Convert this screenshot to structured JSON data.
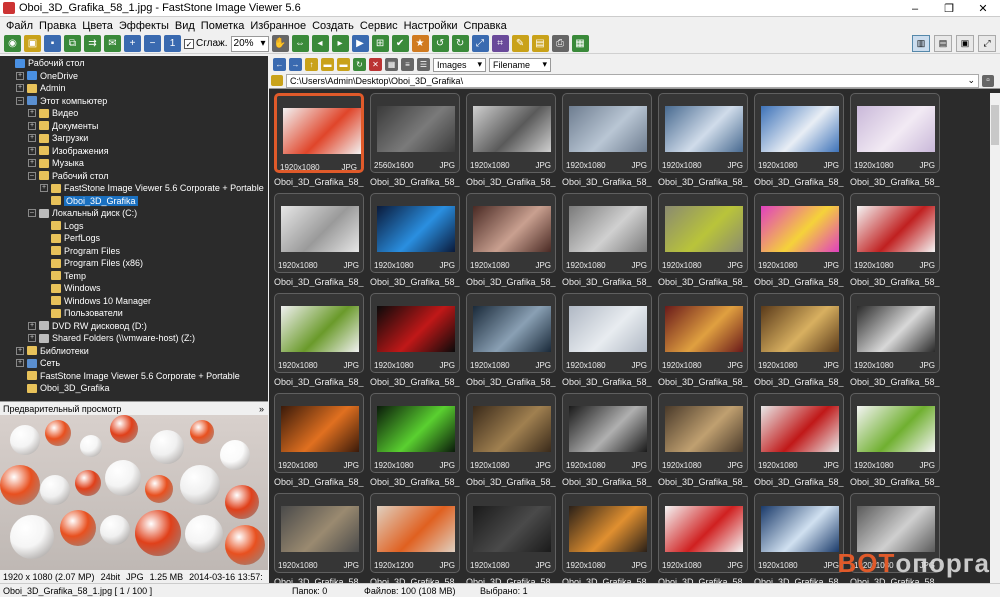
{
  "window": {
    "title": "Oboi_3D_Grafika_58_1.jpg - FastStone Image Viewer 5.6",
    "minimize": "–",
    "maximize": "❐",
    "close": "✕"
  },
  "menu": [
    "Файл",
    "Правка",
    "Цвета",
    "Эффекты",
    "Вид",
    "Пометка",
    "Избранное",
    "Создать",
    "Сервис",
    "Настройки",
    "Справка"
  ],
  "toolbar": {
    "smooth_label": "Сглаж.",
    "zoom_value": "20%"
  },
  "tree": [
    {
      "label": "Рабочий стол",
      "indent": 0,
      "exp": "",
      "icon": "desktop"
    },
    {
      "label": "OneDrive",
      "indent": 1,
      "exp": "+",
      "icon": "cloud"
    },
    {
      "label": "Admin",
      "indent": 1,
      "exp": "+",
      "icon": "user"
    },
    {
      "label": "Этот компьютер",
      "indent": 1,
      "exp": "–",
      "icon": "pc"
    },
    {
      "label": "Видео",
      "indent": 2,
      "exp": "+",
      "icon": "folder"
    },
    {
      "label": "Документы",
      "indent": 2,
      "exp": "+",
      "icon": "folder"
    },
    {
      "label": "Загрузки",
      "indent": 2,
      "exp": "+",
      "icon": "folder"
    },
    {
      "label": "Изображения",
      "indent": 2,
      "exp": "+",
      "icon": "folder"
    },
    {
      "label": "Музыка",
      "indent": 2,
      "exp": "+",
      "icon": "folder"
    },
    {
      "label": "Рабочий стол",
      "indent": 2,
      "exp": "–",
      "icon": "folder"
    },
    {
      "label": "FastStone Image Viewer 5.6 Corporate + Portable",
      "indent": 3,
      "exp": "+",
      "icon": "folder"
    },
    {
      "label": "Oboi_3D_Grafika",
      "indent": 3,
      "exp": "",
      "icon": "folder",
      "selected": true
    },
    {
      "label": "Локальный диск (C:)",
      "indent": 2,
      "exp": "–",
      "icon": "drive"
    },
    {
      "label": "Logs",
      "indent": 3,
      "exp": "",
      "icon": "folder"
    },
    {
      "label": "PerfLogs",
      "indent": 3,
      "exp": "",
      "icon": "folder"
    },
    {
      "label": "Program Files",
      "indent": 3,
      "exp": "",
      "icon": "folder"
    },
    {
      "label": "Program Files (x86)",
      "indent": 3,
      "exp": "",
      "icon": "folder"
    },
    {
      "label": "Temp",
      "indent": 3,
      "exp": "",
      "icon": "folder"
    },
    {
      "label": "Windows",
      "indent": 3,
      "exp": "",
      "icon": "folder"
    },
    {
      "label": "Windows 10 Manager",
      "indent": 3,
      "exp": "",
      "icon": "folder"
    },
    {
      "label": "Пользователи",
      "indent": 3,
      "exp": "",
      "icon": "folder"
    },
    {
      "label": "DVD RW дисковод (D:)",
      "indent": 2,
      "exp": "+",
      "icon": "drive"
    },
    {
      "label": "Shared Folders (\\\\vmware-host) (Z:)",
      "indent": 2,
      "exp": "+",
      "icon": "drive"
    },
    {
      "label": "Библиотеки",
      "indent": 1,
      "exp": "+",
      "icon": "folder"
    },
    {
      "label": "Сеть",
      "indent": 1,
      "exp": "+",
      "icon": "pc"
    },
    {
      "label": "FastStone Image Viewer 5.6 Corporate + Portable",
      "indent": 1,
      "exp": "",
      "icon": "folder"
    },
    {
      "label": "Oboi_3D_Grafika",
      "indent": 1,
      "exp": "",
      "icon": "folder"
    }
  ],
  "preview": {
    "header": "Предварительный просмотр",
    "collapse": "»"
  },
  "info": {
    "resolution": "1920 x 1080 (2.07 MP)",
    "bits": "24bit",
    "format": "JPG",
    "size": "1.25 MB",
    "date": "2014-03-16 13:57:"
  },
  "browser": {
    "filter": "Images",
    "sort": "Filename",
    "path": "C:\\Users\\Admin\\Desktop\\Oboi_3D_Grafika\\"
  },
  "thumbs": [
    {
      "dim": "1920x1080",
      "type": "JPG",
      "name": "Oboi_3D_Grafika_58_...",
      "c1": "#f2f2f2",
      "c2": "#e0452a",
      "selected": true
    },
    {
      "dim": "2560x1600",
      "type": "JPG",
      "name": "Oboi_3D_Grafika_58_...",
      "c1": "#3a3a3a",
      "c2": "#7a7a7a"
    },
    {
      "dim": "1920x1080",
      "type": "JPG",
      "name": "Oboi_3D_Grafika_58_...",
      "c1": "#cfcfcf",
      "c2": "#5a5a5a"
    },
    {
      "dim": "1920x1080",
      "type": "JPG",
      "name": "Oboi_3D_Grafika_58_...",
      "c1": "#6e7d90",
      "c2": "#b9c6d4"
    },
    {
      "dim": "1920x1080",
      "type": "JPG",
      "name": "Oboi_3D_Grafika_58_...",
      "c1": "#486a90",
      "c2": "#d0dcea"
    },
    {
      "dim": "1920x1080",
      "type": "JPG",
      "name": "Oboi_3D_Grafika_58_...",
      "c1": "#3d72b8",
      "c2": "#e8eef5"
    },
    {
      "dim": "1920x1080",
      "type": "JPG",
      "name": "Oboi_3D_Grafika_58_...",
      "c1": "#c9b8d9",
      "c2": "#f2eaf4"
    },
    {
      "dim": "1920x1080",
      "type": "JPG",
      "name": "Oboi_3D_Grafika_58_...",
      "c1": "#e6e6e6",
      "c2": "#9a9a9a"
    },
    {
      "dim": "1920x1080",
      "type": "JPG",
      "name": "Oboi_3D_Grafika_58_...",
      "c1": "#0a1a3a",
      "c2": "#2a8fe0"
    },
    {
      "dim": "1920x1080",
      "type": "JPG",
      "name": "Oboi_3D_Grafika_58_...",
      "c1": "#4a2a24",
      "c2": "#c9a090"
    },
    {
      "dim": "1920x1080",
      "type": "JPG",
      "name": "Oboi_3D_Grafika_58_...",
      "c1": "#7a7a7a",
      "c2": "#d0d0d0"
    },
    {
      "dim": "1920x1080",
      "type": "JPG",
      "name": "Oboi_3D_Grafika_58_...",
      "c1": "#8a8a70",
      "c2": "#b9c43a"
    },
    {
      "dim": "1920x1080",
      "type": "JPG",
      "name": "Oboi_3D_Grafika_58_...",
      "c1": "#e040c0",
      "c2": "#f5d23a"
    },
    {
      "dim": "1920x1080",
      "type": "JPG",
      "name": "Oboi_3D_Grafika_58_...",
      "c1": "#f4f4f4",
      "c2": "#c02020"
    },
    {
      "dim": "1920x1080",
      "type": "JPG",
      "name": "Oboi_3D_Grafika_58_...",
      "c1": "#f0f0f0",
      "c2": "#6a9a2a"
    },
    {
      "dim": "1920x1080",
      "type": "JPG",
      "name": "Oboi_3D_Grafika_58_...",
      "c1": "#0a0a0a",
      "c2": "#c01818"
    },
    {
      "dim": "1920x1080",
      "type": "JPG",
      "name": "Oboi_3D_Grafika_58_...",
      "c1": "#1a2a3a",
      "c2": "#8aa0b4"
    },
    {
      "dim": "1920x1080",
      "type": "JPG",
      "name": "Oboi_3D_Grafika_58_...",
      "c1": "#b0b8c4",
      "c2": "#e8ecf0"
    },
    {
      "dim": "1920x1080",
      "type": "JPG",
      "name": "Oboi_3D_Grafika_58_...",
      "c1": "#6a1a1a",
      "c2": "#e0a040"
    },
    {
      "dim": "1920x1080",
      "type": "JPG",
      "name": "Oboi_3D_Grafika_58_...",
      "c1": "#5a3a1a",
      "c2": "#d8b060"
    },
    {
      "dim": "1920x1080",
      "type": "JPG",
      "name": "Oboi_3D_Grafika_58_...",
      "c1": "#2a2a2a",
      "c2": "#d8d8d8"
    },
    {
      "dim": "1920x1080",
      "type": "JPG",
      "name": "Oboi_3D_Grafika_58_...",
      "c1": "#3a1a0a",
      "c2": "#e07020"
    },
    {
      "dim": "1920x1080",
      "type": "JPG",
      "name": "Oboi_3D_Grafika_58_...",
      "c1": "#0a1a0a",
      "c2": "#5ad030"
    },
    {
      "dim": "1920x1080",
      "type": "JPG",
      "name": "Oboi_3D_Grafika_58_...",
      "c1": "#3a2a1a",
      "c2": "#a08050"
    },
    {
      "dim": "1920x1080",
      "type": "JPG",
      "name": "Oboi_3D_Grafika_58_...",
      "c1": "#1a1a1a",
      "c2": "#b0b0b0"
    },
    {
      "dim": "1920x1080",
      "type": "JPG",
      "name": "Oboi_3D_Grafika_58_...",
      "c1": "#4a3a2a",
      "c2": "#c0a070"
    },
    {
      "dim": "1920x1080",
      "type": "JPG",
      "name": "Oboi_3D_Grafika_58_...",
      "c1": "#e8e8e8",
      "c2": "#c01818"
    },
    {
      "dim": "1920x1080",
      "type": "JPG",
      "name": "Oboi_3D_Grafika_58_...",
      "c1": "#f4f4f4",
      "c2": "#70b030"
    },
    {
      "dim": "1920x1080",
      "type": "JPG",
      "name": "Oboi_3D_Grafika_58_...",
      "c1": "#4a4a4a",
      "c2": "#9a8a70"
    },
    {
      "dim": "1920x1200",
      "type": "JPG",
      "name": "Oboi_3D_Grafika_58_...",
      "c1": "#e0d0c0",
      "c2": "#e06020"
    },
    {
      "dim": "1920x1080",
      "type": "JPG",
      "name": "Oboi_3D_Grafika_58_...",
      "c1": "#1a1a1a",
      "c2": "#4a4a4a"
    },
    {
      "dim": "1920x1080",
      "type": "JPG",
      "name": "Oboi_3D_Grafika_58_...",
      "c1": "#2a2018",
      "c2": "#e09030"
    },
    {
      "dim": "1920x1080",
      "type": "JPG",
      "name": "Oboi_3D_Grafika_58_...",
      "c1": "#f4f4f4",
      "c2": "#d02020"
    },
    {
      "dim": "1920x1080",
      "type": "JPG",
      "name": "Oboi_3D_Grafika_58_...",
      "c1": "#1a3a6a",
      "c2": "#d0e0f0"
    },
    {
      "dim": "1920x1080",
      "type": "JPG",
      "name": "Oboi_3D_Grafika_58_...",
      "c1": "#5a5a5a",
      "c2": "#cfcfcf"
    }
  ],
  "status": {
    "file": "Oboi_3D_Grafika_58_1.jpg [ 1 / 100 ]",
    "folders": "Папок: 0",
    "files": "Файлов: 100 (108 MB)",
    "selected": "Выбрано: 1"
  },
  "watermark": {
    "part1": "BOT",
    "part2": "опорга"
  }
}
